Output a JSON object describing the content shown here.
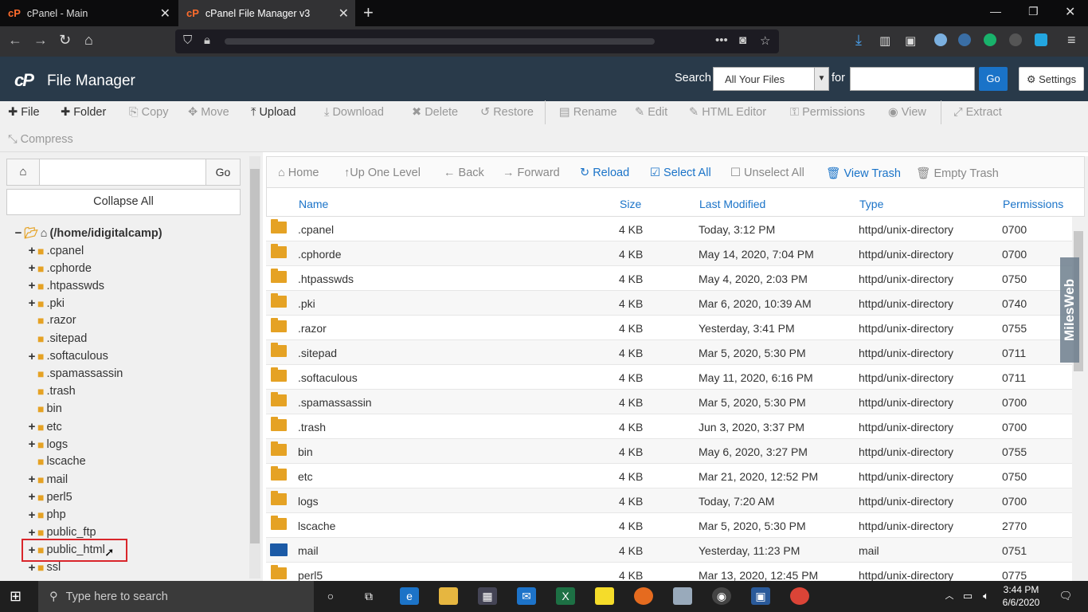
{
  "browser": {
    "tabs": [
      {
        "label": "cPanel - Main",
        "active": false
      },
      {
        "label": "cPanel File Manager v3",
        "active": true
      }
    ]
  },
  "header": {
    "logo": "cP",
    "title": "File Manager",
    "search_label": "Search",
    "search_scope": "All Your Files",
    "for_label": "for",
    "go_label": "Go",
    "settings_label": "Settings"
  },
  "toolbar": {
    "file": "File",
    "folder": "Folder",
    "copy": "Copy",
    "move": "Move",
    "upload": "Upload",
    "download": "Download",
    "delete": "Delete",
    "restore": "Restore",
    "rename": "Rename",
    "edit": "Edit",
    "html_editor": "HTML Editor",
    "permissions": "Permissions",
    "view": "View",
    "extract": "Extract",
    "compress": "Compress"
  },
  "sidebar": {
    "go_label": "Go",
    "collapse_label": "Collapse All",
    "root": "(/home/idigitalcamp)",
    "items": [
      {
        "label": ".cpanel",
        "expandable": true
      },
      {
        "label": ".cphorde",
        "expandable": true
      },
      {
        "label": ".htpasswds",
        "expandable": true
      },
      {
        "label": ".pki",
        "expandable": true
      },
      {
        "label": ".razor",
        "expandable": false
      },
      {
        "label": ".sitepad",
        "expandable": false
      },
      {
        "label": ".softaculous",
        "expandable": true
      },
      {
        "label": ".spamassassin",
        "expandable": false
      },
      {
        "label": ".trash",
        "expandable": false
      },
      {
        "label": "bin",
        "expandable": false
      },
      {
        "label": "etc",
        "expandable": true
      },
      {
        "label": "logs",
        "expandable": true
      },
      {
        "label": "lscache",
        "expandable": false
      },
      {
        "label": "mail",
        "expandable": true
      },
      {
        "label": "perl5",
        "expandable": true
      },
      {
        "label": "php",
        "expandable": true
      },
      {
        "label": "public_ftp",
        "expandable": true
      },
      {
        "label": "public_html",
        "expandable": true
      },
      {
        "label": "ssl",
        "expandable": true
      }
    ]
  },
  "main_nav": {
    "home": "Home",
    "up": "Up One Level",
    "back": "Back",
    "forward": "Forward",
    "reload": "Reload",
    "select_all": "Select All",
    "unselect_all": "Unselect All",
    "view_trash": "View Trash",
    "empty_trash": "Empty Trash"
  },
  "table": {
    "headers": [
      "Name",
      "Size",
      "Last Modified",
      "Type",
      "Permissions"
    ],
    "rows": [
      [
        ".cpanel",
        "4 KB",
        "Today, 3:12 PM",
        "httpd/unix-directory",
        "0700"
      ],
      [
        ".cphorde",
        "4 KB",
        "May 14, 2020, 7:04 PM",
        "httpd/unix-directory",
        "0700"
      ],
      [
        ".htpasswds",
        "4 KB",
        "May 4, 2020, 2:03 PM",
        "httpd/unix-directory",
        "0750"
      ],
      [
        ".pki",
        "4 KB",
        "Mar 6, 2020, 10:39 AM",
        "httpd/unix-directory",
        "0740"
      ],
      [
        ".razor",
        "4 KB",
        "Yesterday, 3:41 PM",
        "httpd/unix-directory",
        "0755"
      ],
      [
        ".sitepad",
        "4 KB",
        "Mar 5, 2020, 5:30 PM",
        "httpd/unix-directory",
        "0711"
      ],
      [
        ".softaculous",
        "4 KB",
        "May 11, 2020, 6:16 PM",
        "httpd/unix-directory",
        "0711"
      ],
      [
        ".spamassassin",
        "4 KB",
        "Mar 5, 2020, 5:30 PM",
        "httpd/unix-directory",
        "0700"
      ],
      [
        ".trash",
        "4 KB",
        "Jun 3, 2020, 3:37 PM",
        "httpd/unix-directory",
        "0700"
      ],
      [
        "bin",
        "4 KB",
        "May 6, 2020, 3:27 PM",
        "httpd/unix-directory",
        "0755"
      ],
      [
        "etc",
        "4 KB",
        "Mar 21, 2020, 12:52 PM",
        "httpd/unix-directory",
        "0750"
      ],
      [
        "logs",
        "4 KB",
        "Today, 7:20 AM",
        "httpd/unix-directory",
        "0700"
      ],
      [
        "lscache",
        "4 KB",
        "Mar 5, 2020, 5:30 PM",
        "httpd/unix-directory",
        "2770"
      ],
      [
        "mail",
        "4 KB",
        "Yesterday, 11:23 PM",
        "mail",
        "0751"
      ],
      [
        "perl5",
        "4 KB",
        "Mar 13, 2020, 12:45 PM",
        "httpd/unix-directory",
        "0775"
      ]
    ]
  },
  "watermark": "MilesWeb",
  "taskbar": {
    "search_placeholder": "Type here to search",
    "time": "3:44 PM",
    "date": "6/6/2020",
    "notifications": "1"
  }
}
